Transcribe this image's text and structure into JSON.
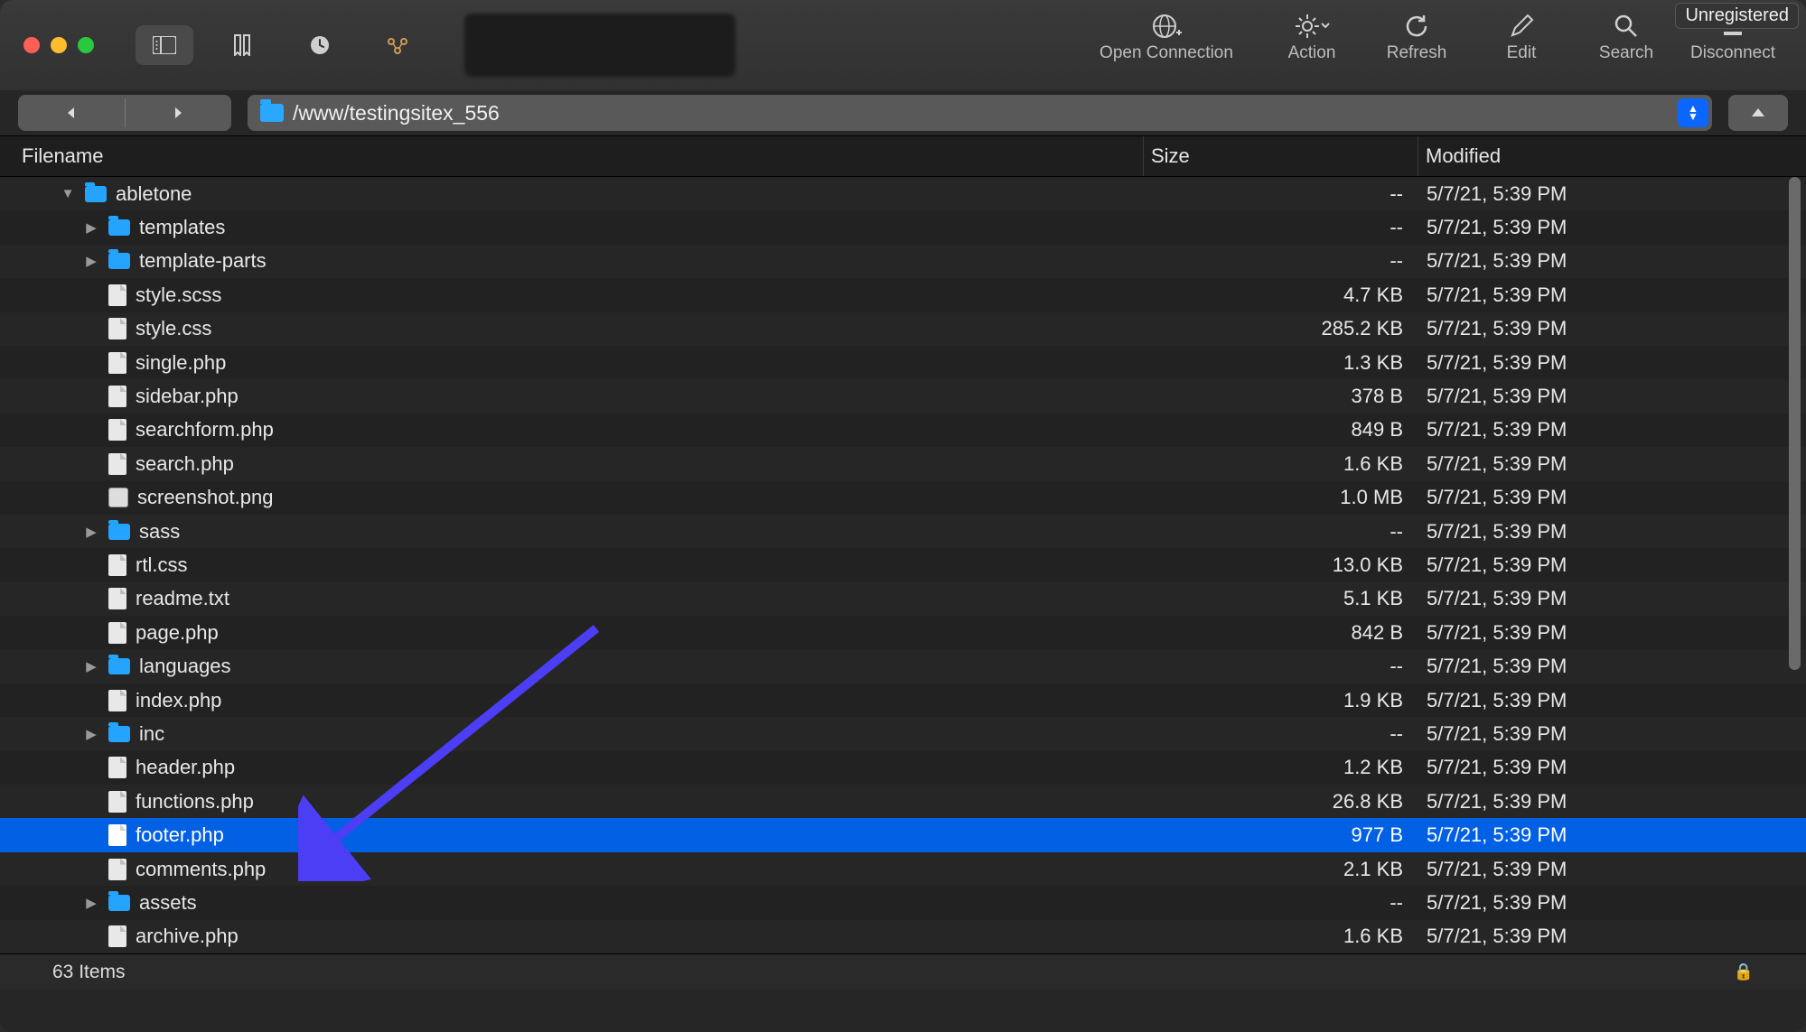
{
  "badge": "Unregistered",
  "toolbar": {
    "open_connection": "Open Connection",
    "action": "Action",
    "refresh": "Refresh",
    "edit": "Edit",
    "search": "Search",
    "disconnect": "Disconnect"
  },
  "path": "/www/testingsitex_556",
  "columns": {
    "filename": "Filename",
    "size": "Size",
    "modified": "Modified"
  },
  "rows": [
    {
      "name": "abletone",
      "type": "folder",
      "indent": 0,
      "disclosure": "down",
      "size": "--",
      "modified": "5/7/21, 5:39 PM",
      "selected": false
    },
    {
      "name": "templates",
      "type": "folder",
      "indent": 1,
      "disclosure": "right",
      "size": "--",
      "modified": "5/7/21, 5:39 PM",
      "selected": false
    },
    {
      "name": "template-parts",
      "type": "folder",
      "indent": 1,
      "disclosure": "right",
      "size": "--",
      "modified": "5/7/21, 5:39 PM",
      "selected": false
    },
    {
      "name": "style.scss",
      "type": "file",
      "indent": 1,
      "disclosure": "",
      "size": "4.7 KB",
      "modified": "5/7/21, 5:39 PM",
      "selected": false
    },
    {
      "name": "style.css",
      "type": "file",
      "indent": 1,
      "disclosure": "",
      "size": "285.2 KB",
      "modified": "5/7/21, 5:39 PM",
      "selected": false
    },
    {
      "name": "single.php",
      "type": "file",
      "indent": 1,
      "disclosure": "",
      "size": "1.3 KB",
      "modified": "5/7/21, 5:39 PM",
      "selected": false
    },
    {
      "name": "sidebar.php",
      "type": "file",
      "indent": 1,
      "disclosure": "",
      "size": "378 B",
      "modified": "5/7/21, 5:39 PM",
      "selected": false
    },
    {
      "name": "searchform.php",
      "type": "file",
      "indent": 1,
      "disclosure": "",
      "size": "849 B",
      "modified": "5/7/21, 5:39 PM",
      "selected": false
    },
    {
      "name": "search.php",
      "type": "file",
      "indent": 1,
      "disclosure": "",
      "size": "1.6 KB",
      "modified": "5/7/21, 5:39 PM",
      "selected": false
    },
    {
      "name": "screenshot.png",
      "type": "image",
      "indent": 1,
      "disclosure": "",
      "size": "1.0 MB",
      "modified": "5/7/21, 5:39 PM",
      "selected": false
    },
    {
      "name": "sass",
      "type": "folder",
      "indent": 1,
      "disclosure": "right",
      "size": "--",
      "modified": "5/7/21, 5:39 PM",
      "selected": false
    },
    {
      "name": "rtl.css",
      "type": "file",
      "indent": 1,
      "disclosure": "",
      "size": "13.0 KB",
      "modified": "5/7/21, 5:39 PM",
      "selected": false
    },
    {
      "name": "readme.txt",
      "type": "file",
      "indent": 1,
      "disclosure": "",
      "size": "5.1 KB",
      "modified": "5/7/21, 5:39 PM",
      "selected": false
    },
    {
      "name": "page.php",
      "type": "file",
      "indent": 1,
      "disclosure": "",
      "size": "842 B",
      "modified": "5/7/21, 5:39 PM",
      "selected": false
    },
    {
      "name": "languages",
      "type": "folder",
      "indent": 1,
      "disclosure": "right",
      "size": "--",
      "modified": "5/7/21, 5:39 PM",
      "selected": false
    },
    {
      "name": "index.php",
      "type": "file",
      "indent": 1,
      "disclosure": "",
      "size": "1.9 KB",
      "modified": "5/7/21, 5:39 PM",
      "selected": false
    },
    {
      "name": "inc",
      "type": "folder",
      "indent": 1,
      "disclosure": "right",
      "size": "--",
      "modified": "5/7/21, 5:39 PM",
      "selected": false
    },
    {
      "name": "header.php",
      "type": "file",
      "indent": 1,
      "disclosure": "",
      "size": "1.2 KB",
      "modified": "5/7/21, 5:39 PM",
      "selected": false
    },
    {
      "name": "functions.php",
      "type": "file",
      "indent": 1,
      "disclosure": "",
      "size": "26.8 KB",
      "modified": "5/7/21, 5:39 PM",
      "selected": false
    },
    {
      "name": "footer.php",
      "type": "file",
      "indent": 1,
      "disclosure": "",
      "size": "977 B",
      "modified": "5/7/21, 5:39 PM",
      "selected": true
    },
    {
      "name": "comments.php",
      "type": "file",
      "indent": 1,
      "disclosure": "",
      "size": "2.1 KB",
      "modified": "5/7/21, 5:39 PM",
      "selected": false
    },
    {
      "name": "assets",
      "type": "folder",
      "indent": 1,
      "disclosure": "right",
      "size": "--",
      "modified": "5/7/21, 5:39 PM",
      "selected": false
    },
    {
      "name": "archive.php",
      "type": "file",
      "indent": 1,
      "disclosure": "",
      "size": "1.6 KB",
      "modified": "5/7/21, 5:39 PM",
      "selected": false
    }
  ],
  "status": {
    "items": "63 Items"
  }
}
